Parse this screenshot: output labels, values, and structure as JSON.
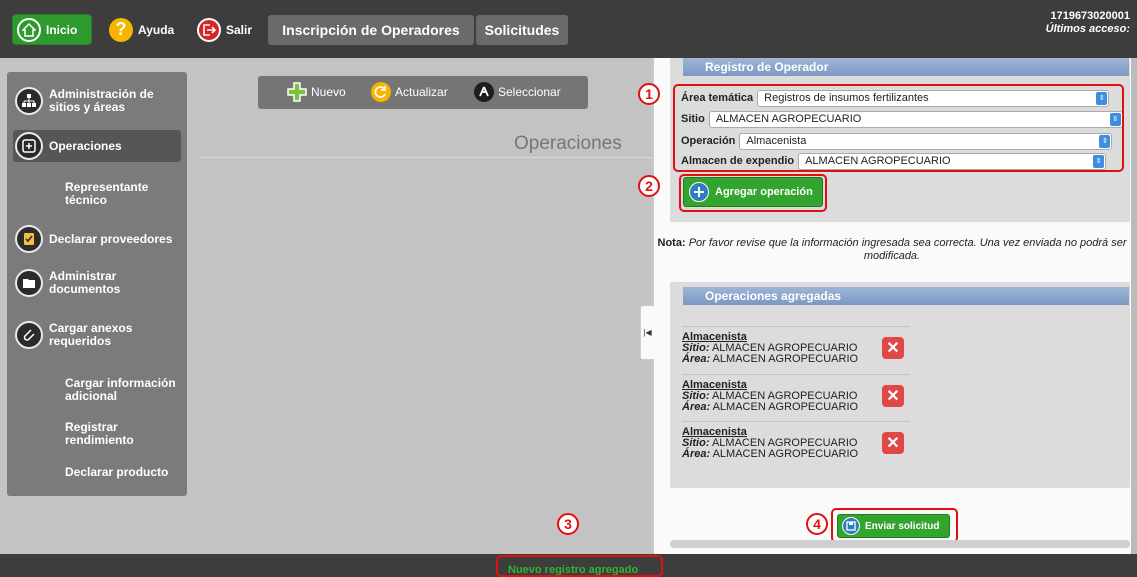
{
  "topbar": {
    "inicio_label": "Inicio",
    "ayuda_label": "Ayuda",
    "salir_label": "Salir",
    "tab_inscripcion": "Inscripción de Operadores",
    "tab_solicitudes": "Solicitudes",
    "user_id": "1719673020001",
    "last_access": "Últimos acceso:"
  },
  "sidebar": {
    "items": [
      {
        "label": "Administración de sitios y áreas",
        "icon": "network-icon"
      },
      {
        "label": "Operaciones",
        "icon": "operations-icon"
      },
      {
        "label": "Representante técnico",
        "icon": ""
      },
      {
        "label": "Declarar proveedores",
        "icon": "clipboard-icon"
      },
      {
        "label": "Administrar documentos",
        "icon": "folder-icon"
      },
      {
        "label": "Cargar anexos requeridos",
        "icon": "paperclip-icon"
      },
      {
        "label": "Cargar información adicional",
        "icon": ""
      },
      {
        "label": "Registrar rendimiento",
        "icon": ""
      },
      {
        "label": "Declarar producto",
        "icon": ""
      }
    ]
  },
  "toolbar": {
    "nuevo": "Nuevo",
    "actualizar": "Actualizar",
    "seleccionar": "Seleccionar"
  },
  "main": {
    "title": "Operaciones"
  },
  "registro": {
    "header": "Registro de Operador",
    "area_label": "Área temática",
    "area_value": "Registros de insumos fertilizantes",
    "sitio_label": "Sitio",
    "sitio_value": "ALMACEN AGROPECUARIO",
    "operacion_label": "Operación",
    "operacion_value": "Almacenista",
    "almacen_label": "Almacen de expendio",
    "almacen_value": "ALMACEN AGROPECUARIO",
    "add_button": "Agregar operación"
  },
  "nota": {
    "label": "Nota:",
    "text": "Por favor revise que la información ingresada sea correcta. Una vez enviada no podrá ser modificada."
  },
  "operaciones_agregadas": {
    "header": "Operaciones agregadas",
    "sitio_prefix": "Sitio:",
    "area_prefix": "Área:",
    "items": [
      {
        "name": "Almacenista",
        "sitio": "ALMACEN AGROPECUARIO",
        "area": "ALMACEN AGROPECUARIO"
      },
      {
        "name": "Almacenista",
        "sitio": "ALMACEN AGROPECUARIO",
        "area": "ALMACEN AGROPECUARIO"
      },
      {
        "name": "Almacenista",
        "sitio": "ALMACEN AGROPECUARIO",
        "area": "ALMACEN AGROPECUARIO"
      }
    ]
  },
  "send_button": "Enviar solicitud",
  "status_message": "Nuevo registro agregado",
  "markers": [
    "1",
    "2",
    "3",
    "4"
  ],
  "colors": {
    "accent_green": "#33a52e",
    "annotation_red": "#e01010",
    "header_blue": "#7c98c2",
    "select_blue": "#3f8de0"
  }
}
